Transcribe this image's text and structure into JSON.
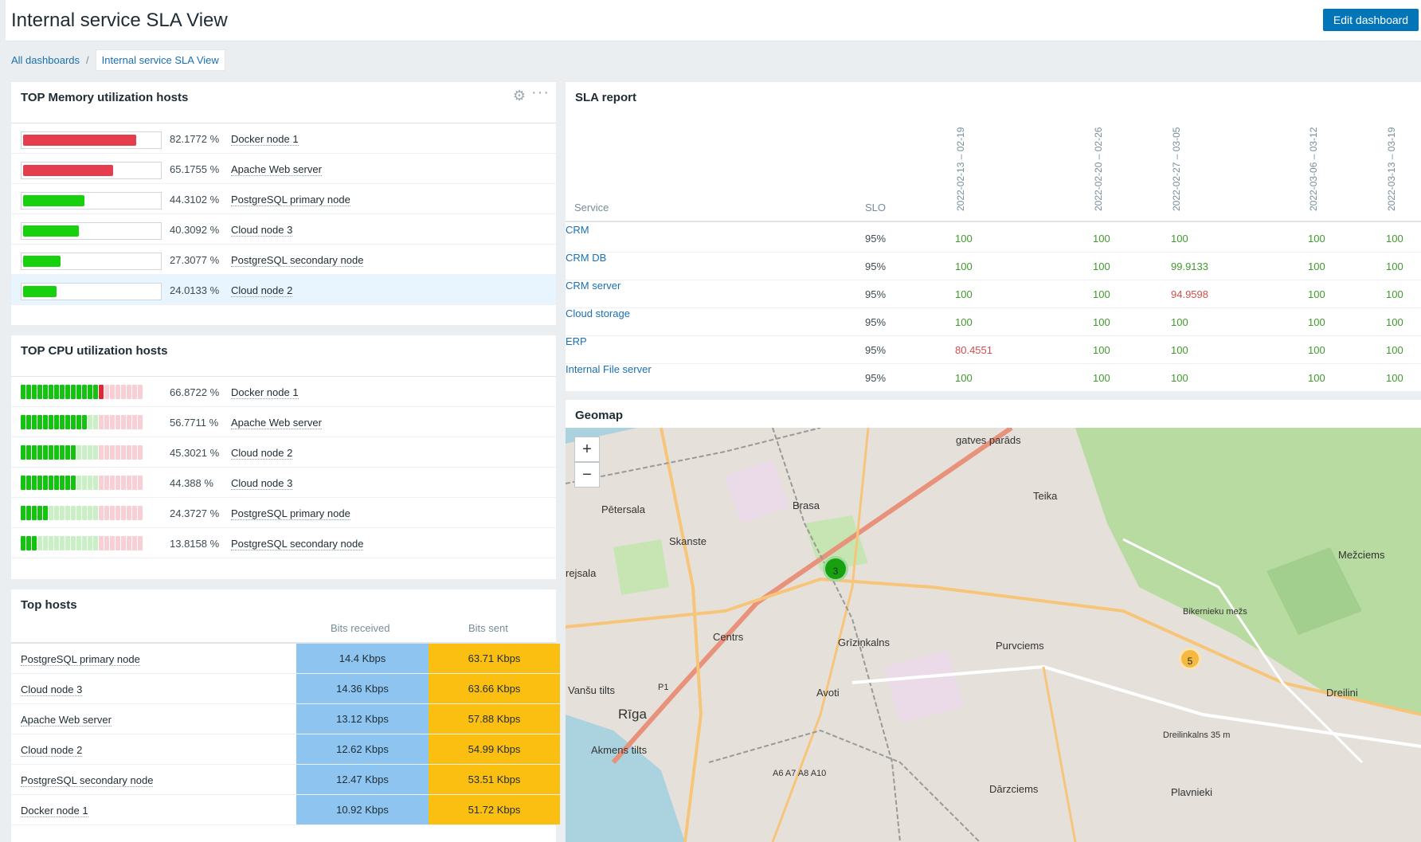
{
  "header": {
    "title": "Internal service SLA View",
    "edit_label": "Edit dashboard"
  },
  "breadcrumb": {
    "root": "All dashboards",
    "separator": "/",
    "current": "Internal service SLA View"
  },
  "memory": {
    "title": "TOP Memory utilization hosts",
    "rows": [
      {
        "pct": "82.1772 %",
        "value": 82.1772,
        "host": "Docker node 1",
        "color": "#e53c4e"
      },
      {
        "pct": "65.1755 %",
        "value": 65.1755,
        "host": "Apache Web server",
        "color": "#e53c4e"
      },
      {
        "pct": "44.3102 %",
        "value": 44.3102,
        "host": "PostgreSQL primary node",
        "color": "#17d10f"
      },
      {
        "pct": "40.3092 %",
        "value": 40.3092,
        "host": "Cloud node 3",
        "color": "#17d10f"
      },
      {
        "pct": "27.3077 %",
        "value": 27.3077,
        "host": "PostgreSQL secondary node",
        "color": "#17d10f"
      },
      {
        "pct": "24.0133 %",
        "value": 24.0133,
        "host": "Cloud node 2",
        "color": "#17d10f"
      }
    ]
  },
  "cpu": {
    "title": "TOP CPU utilization hosts",
    "rows": [
      {
        "pct": "66.8722 %",
        "value": 66.8722,
        "host": "Docker node 1"
      },
      {
        "pct": "56.7711 %",
        "value": 56.7711,
        "host": "Apache Web server"
      },
      {
        "pct": "45.3021 %",
        "value": 45.3021,
        "host": "Cloud node 2"
      },
      {
        "pct": "44.388 %",
        "value": 44.388,
        "host": "Cloud node 3"
      },
      {
        "pct": "24.3727 %",
        "value": 24.3727,
        "host": "PostgreSQL primary node"
      },
      {
        "pct": "13.8158 %",
        "value": 13.8158,
        "host": "PostgreSQL secondary node"
      }
    ]
  },
  "tophosts": {
    "title": "Top hosts",
    "col_rx": "Bits received",
    "col_tx": "Bits sent",
    "rows": [
      {
        "name": "PostgreSQL primary node",
        "rx": "14.4 Kbps",
        "tx": "63.71 Kbps"
      },
      {
        "name": "Cloud node 3",
        "rx": "14.36 Kbps",
        "tx": "63.66 Kbps"
      },
      {
        "name": "Apache Web server",
        "rx": "13.12 Kbps",
        "tx": "57.88 Kbps"
      },
      {
        "name": "Cloud node 2",
        "rx": "12.62 Kbps",
        "tx": "54.99 Kbps"
      },
      {
        "name": "PostgreSQL secondary node",
        "rx": "12.47 Kbps",
        "tx": "53.51 Kbps"
      },
      {
        "name": "Docker node 1",
        "rx": "10.92 Kbps",
        "tx": "51.72 Kbps"
      }
    ]
  },
  "sla": {
    "title": "SLA report",
    "col_service": "Service",
    "col_slo": "SLO",
    "periods": [
      "2022-02-13 – 02-19",
      "2022-02-20 – 02-26",
      "2022-02-27 – 03-05",
      "2022-03-06 – 03-12",
      "2022-03-13 – 03-19"
    ],
    "rows": [
      {
        "service": "CRM",
        "slo": "95%",
        "vals": [
          "100",
          "100",
          "100",
          "100",
          "100"
        ],
        "bad": [
          false,
          false,
          false,
          false,
          false
        ]
      },
      {
        "service": "CRM DB",
        "slo": "95%",
        "vals": [
          "100",
          "100",
          "99.9133",
          "100",
          "100"
        ],
        "bad": [
          false,
          false,
          false,
          false,
          false
        ]
      },
      {
        "service": "CRM server",
        "slo": "95%",
        "vals": [
          "100",
          "100",
          "94.9598",
          "100",
          "100"
        ],
        "bad": [
          false,
          false,
          true,
          false,
          false
        ]
      },
      {
        "service": "Cloud storage",
        "slo": "95%",
        "vals": [
          "100",
          "100",
          "100",
          "100",
          "100"
        ],
        "bad": [
          false,
          false,
          false,
          false,
          false
        ]
      },
      {
        "service": "ERP",
        "slo": "95%",
        "vals": [
          "80.4551",
          "100",
          "100",
          "100",
          "100"
        ],
        "bad": [
          true,
          false,
          false,
          false,
          false
        ]
      },
      {
        "service": "Internal File server",
        "slo": "95%",
        "vals": [
          "100",
          "100",
          "100",
          "100",
          "100"
        ],
        "bad": [
          false,
          false,
          false,
          false,
          false
        ]
      }
    ]
  },
  "geomap": {
    "title": "Geomap",
    "zoom_in": "+",
    "zoom_out": "−",
    "labels": [
      "Pētersala",
      "Brasa",
      "Teika",
      "Skanste",
      "Mežciems",
      "rejsala",
      "Centrs",
      "Grīziņkalns",
      "Purvciems",
      "Bikernieku mežs",
      "Avoti",
      "Dreilini",
      "Vanšu tilts",
      "Rīga",
      "Akmens tilts",
      "Dreilinkalns 35 m",
      "Dārzciems",
      "Plavnieki",
      "gatves parāds",
      "P1",
      "A6 A7 A8 A10"
    ],
    "clusters": [
      {
        "count": "3",
        "color": "#18a10e"
      },
      {
        "count": "5",
        "color": "#f6b940"
      }
    ]
  }
}
